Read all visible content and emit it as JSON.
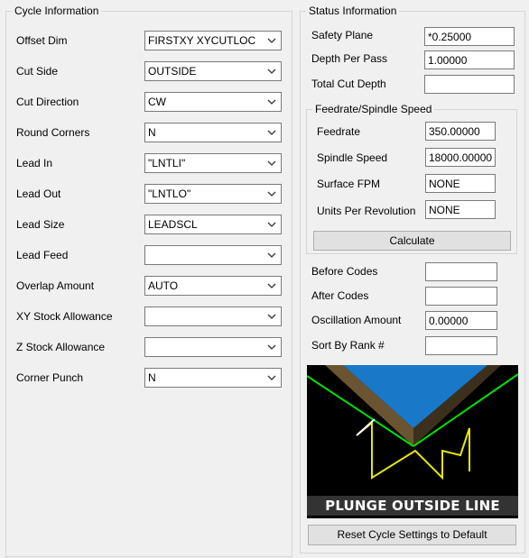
{
  "cycle_info": {
    "title": "Cycle Information",
    "rows": [
      {
        "label": "Offset Dim",
        "value": "FIRSTXY XYCUTLOC"
      },
      {
        "label": "Cut Side",
        "value": "OUTSIDE"
      },
      {
        "label": "Cut Direction",
        "value": "CW"
      },
      {
        "label": "Round Corners",
        "value": "N"
      },
      {
        "label": "Lead In",
        "value": "\"LNTLI\""
      },
      {
        "label": "Lead Out",
        "value": "\"LNTLO\""
      },
      {
        "label": "Lead Size",
        "value": "LEADSCL"
      },
      {
        "label": "Lead Feed",
        "value": ""
      },
      {
        "label": "Overlap Amount",
        "value": "AUTO"
      },
      {
        "label": "XY Stock Allowance",
        "value": ""
      },
      {
        "label": "Z Stock Allowance",
        "value": ""
      },
      {
        "label": "Corner Punch",
        "value": "N"
      }
    ]
  },
  "status_info": {
    "title": "Status Information",
    "safety_plane": {
      "label": "Safety Plane",
      "value": "*0.25000"
    },
    "depth_per_pass": {
      "label": "Depth Per Pass",
      "value": "1.00000"
    },
    "total_cut_depth": {
      "label": "Total Cut Depth",
      "value": ""
    },
    "feed_group": {
      "title": "Feedrate/Spindle Speed",
      "feedrate": {
        "label": "Feedrate",
        "value": "350.00000"
      },
      "spindle_speed": {
        "label": "Spindle Speed",
        "value": "18000.00000"
      },
      "surface_fpm": {
        "label": "Surface FPM",
        "value": "NONE"
      },
      "units_per_rev": {
        "label": "Units Per Revolution",
        "value": "NONE"
      },
      "calculate_label": "Calculate"
    },
    "before_codes": {
      "label": "Before Codes",
      "value": ""
    },
    "after_codes": {
      "label": "After Codes",
      "value": ""
    },
    "oscillation_amount": {
      "label": "Oscillation Amount",
      "value": "0.00000"
    },
    "sort_by_rank": {
      "label": "Sort By Rank #",
      "value": ""
    },
    "preview_caption": "PLUNGE OUTSIDE LINE LEADS",
    "reset_label": "Reset Cycle Settings to Default"
  },
  "colors": {
    "panel_bg": "#f0f0f0",
    "group_border": "#d5d5d5",
    "field_border": "#7a7a7a",
    "button_bg": "#e1e1e1",
    "preview_bg": "#000000",
    "preview_top": "#1a78c8",
    "preview_side": "#6b5432",
    "preview_green": "#00e000",
    "preview_yellow": "#e8e800"
  }
}
